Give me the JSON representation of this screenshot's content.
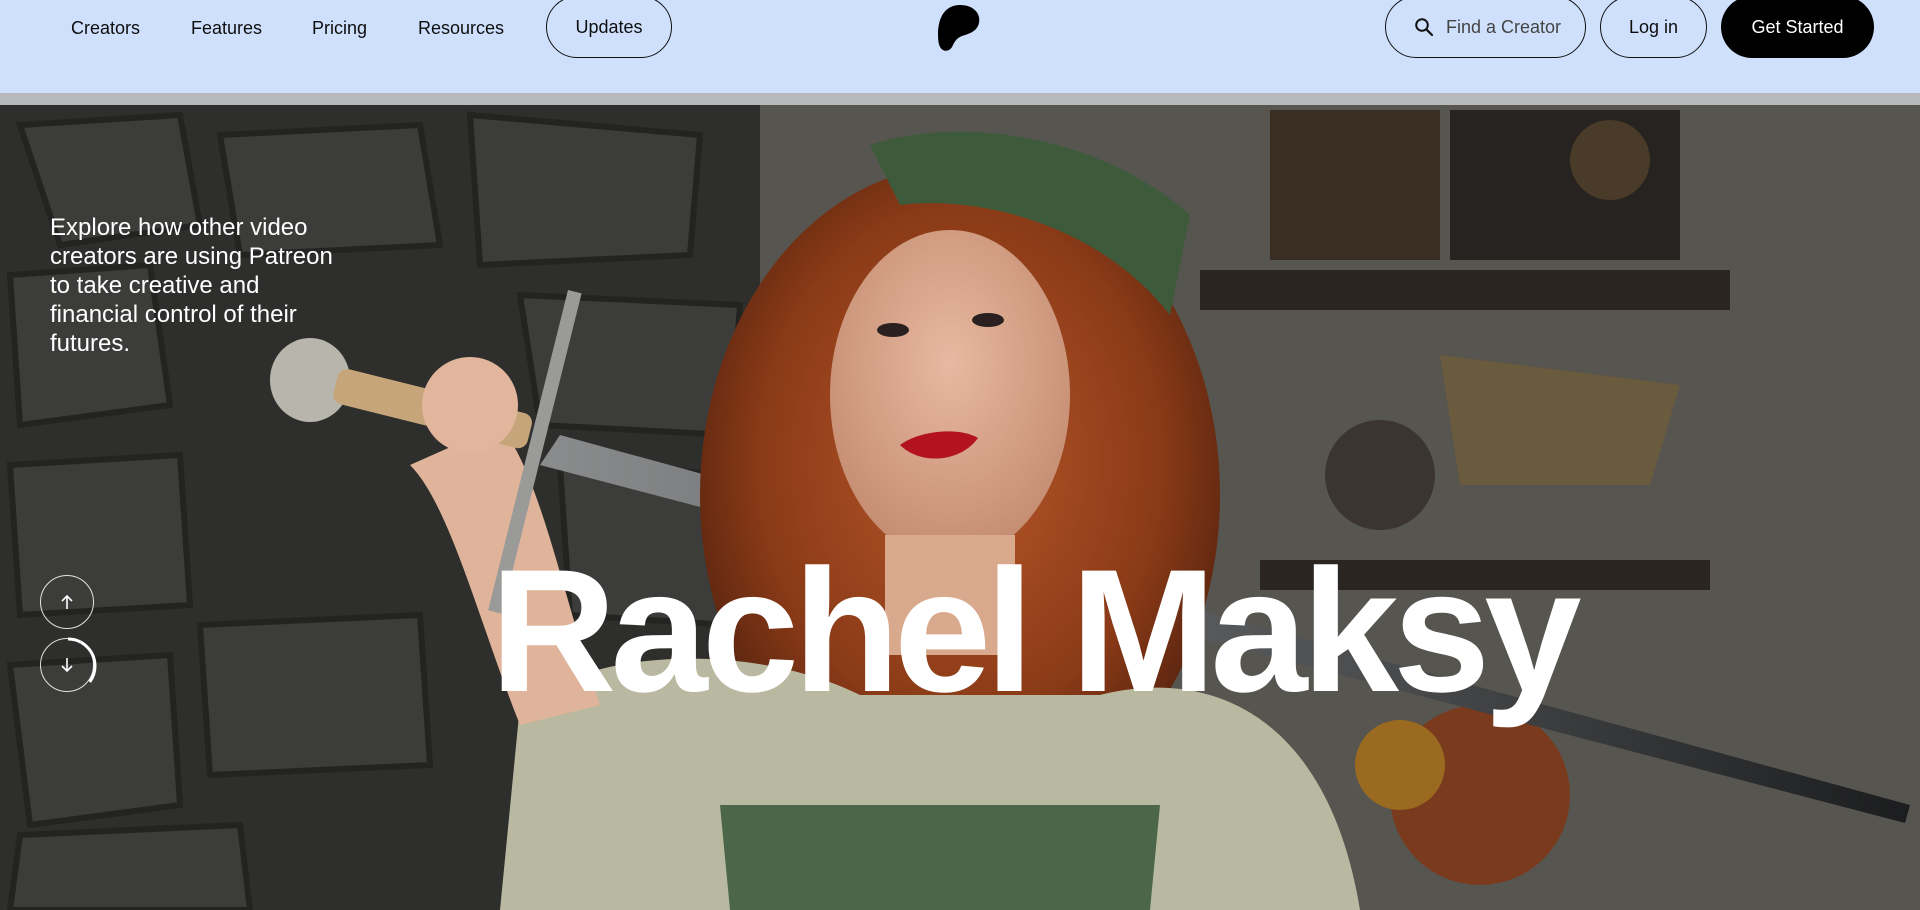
{
  "nav": {
    "links": [
      {
        "label": "Creators"
      },
      {
        "label": "Features"
      },
      {
        "label": "Pricing"
      },
      {
        "label": "Resources"
      }
    ],
    "updates_label": "Updates",
    "search_placeholder": "Find a Creator",
    "login_label": "Log in",
    "get_started_label": "Get Started"
  },
  "hero": {
    "blurb": "Explore how other video creators are using Patreon to take creative and financial control of their futures.",
    "creator_name": "Rachel Maksy",
    "carousel_progress": 0.35
  },
  "colors": {
    "nav_background": "#cfe0fd",
    "get_started_background": "#000000",
    "hero_text": "#ffffff"
  },
  "icons": {
    "logo": "patreon-logo-icon",
    "search": "search-icon",
    "up": "arrow-up-icon",
    "down": "arrow-down-icon"
  }
}
